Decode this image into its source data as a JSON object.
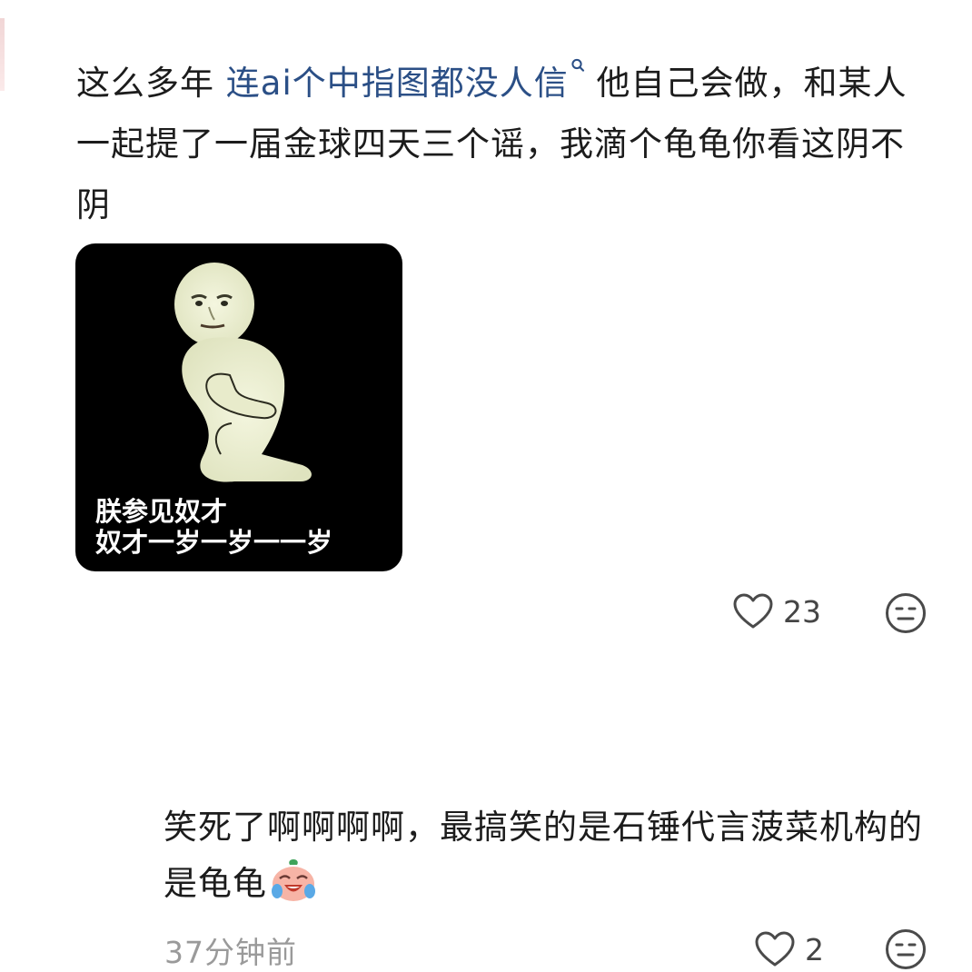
{
  "comment": {
    "text_before": "这么多年 ",
    "search_link": "连ai个中指图都没人信",
    "text_after": " 他自己会做，和某人一起提了一届金球四天三个谣，我滴个龟龟你看这阴不阴",
    "sticker": {
      "caption_line1": "朕参见奴才",
      "caption_line2": "奴才一岁一岁一一岁"
    },
    "like_count": "23"
  },
  "reply": {
    "text": "笑死了啊啊啊啊，最搞笑的是石锤代言菠菜机构的是龟龟",
    "timestamp": "37分钟前",
    "like_count": "2"
  },
  "icons": {
    "like": "heart-outline-icon",
    "react": "neutral-face-icon",
    "search": "search-icon",
    "emoji": "crying-laughing-emoji"
  },
  "colors": {
    "link": "#2b4f86",
    "text": "#1c1c1c",
    "muted": "#9a9a9a"
  }
}
